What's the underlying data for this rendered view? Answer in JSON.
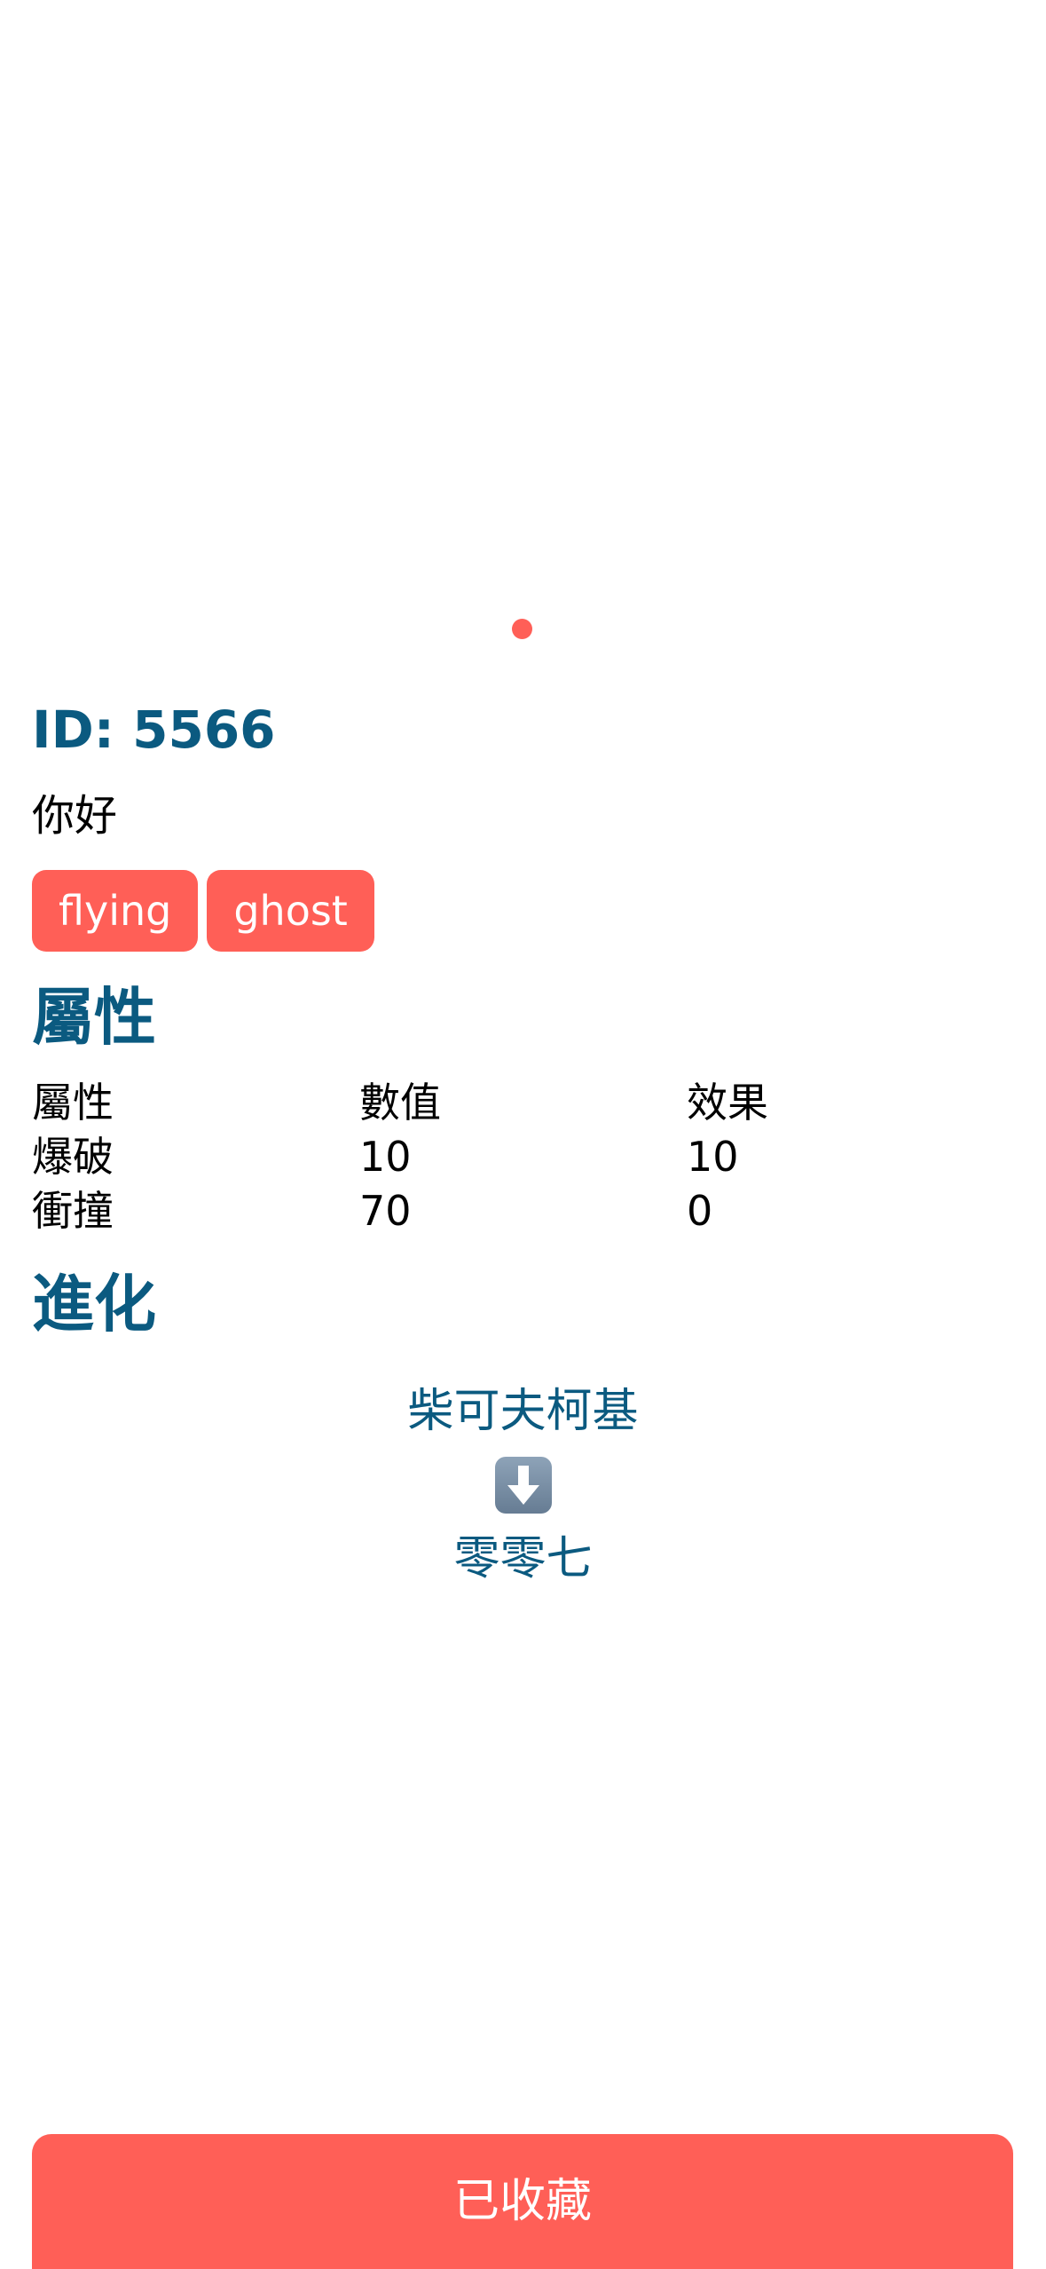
{
  "detail": {
    "id_text": "ID: 5566",
    "name": "你好",
    "tags": [
      "flying",
      "ghost"
    ]
  },
  "attributes": {
    "title": "屬性",
    "headers": [
      "屬性",
      "數值",
      "效果"
    ],
    "rows": [
      [
        "爆破",
        "10",
        "10"
      ],
      [
        "衝撞",
        "70",
        "0"
      ]
    ]
  },
  "evolution": {
    "title": "進化",
    "from": "柴可夫柯基",
    "arrow_icon": "down-arrow-icon",
    "to": "零零七"
  },
  "actions": {
    "collect_label": "已收藏"
  },
  "colors": {
    "accent": "#ff5f57",
    "heading": "#0b5a80"
  }
}
